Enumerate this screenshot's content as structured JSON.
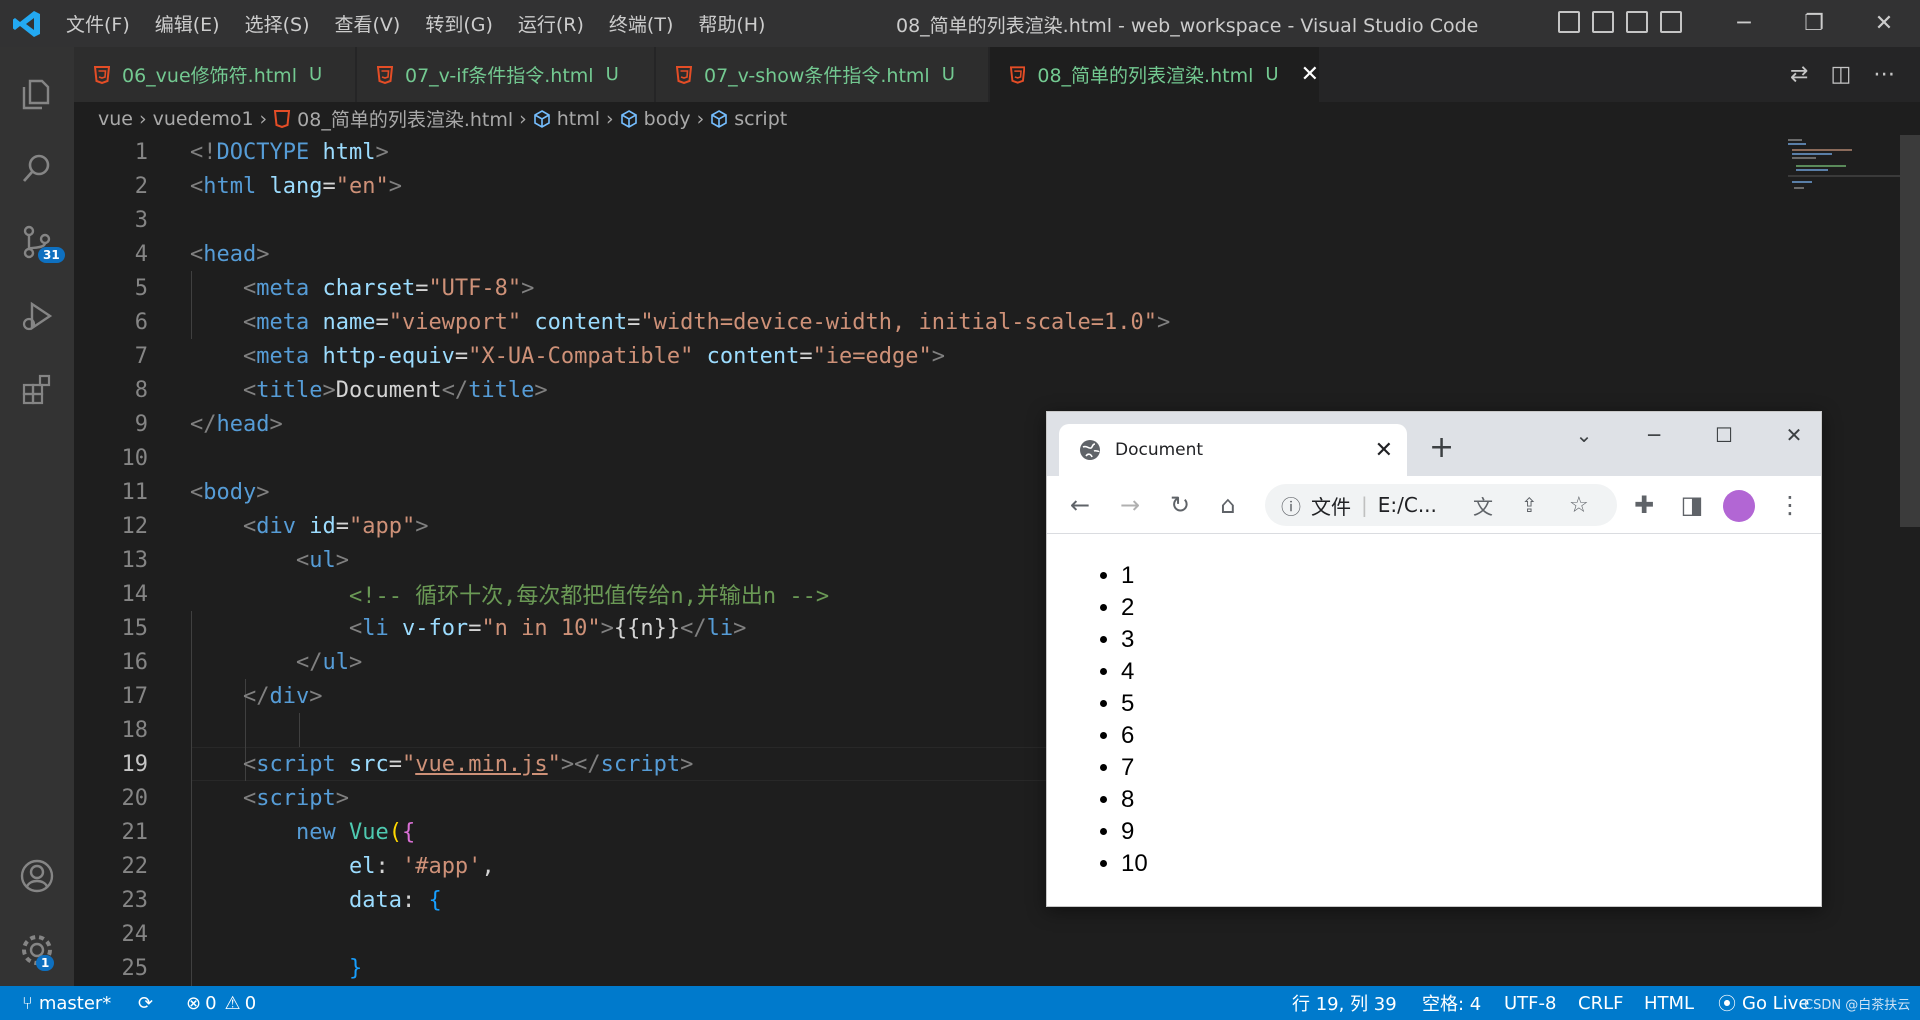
{
  "titlebar": {
    "menu": [
      "文件(F)",
      "编辑(E)",
      "选择(S)",
      "查看(V)",
      "转到(G)",
      "运行(R)",
      "终端(T)",
      "帮助(H)"
    ],
    "window_title": "08_简单的列表渲染.html - web_workspace - Visual Studio Code"
  },
  "activity": {
    "scm_badge": "31",
    "settings_badge": "1"
  },
  "tabs": [
    {
      "label": "06_vue修饰符.html",
      "status": "U"
    },
    {
      "label": "07_v-if条件指令.html",
      "status": "U"
    },
    {
      "label": "07_v-show条件指令.html",
      "status": "U"
    },
    {
      "label": "08_简单的列表渲染.html",
      "status": "U"
    }
  ],
  "breadcrumb": [
    "vue",
    "vuedemo1",
    "08_简单的列表渲染.html",
    "html",
    "body",
    "script"
  ],
  "editor": {
    "line_numbers": [
      "1",
      "2",
      "3",
      "4",
      "5",
      "6",
      "7",
      "8",
      "9",
      "10",
      "11",
      "12",
      "13",
      "14",
      "15",
      "16",
      "17",
      "18",
      "19",
      "20",
      "21",
      "22",
      "23",
      "24",
      "25"
    ],
    "current_line": 19,
    "comment": "<!-- 循环十次,每次都把值传给n,并输出n -->"
  },
  "statusbar": {
    "branch": "master*",
    "errors": "0",
    "warnings": "0",
    "position": "行 19, 列 39",
    "spaces": "空格: 4",
    "encoding": "UTF-8",
    "eol": "CRLF",
    "language": "HTML",
    "golive": "Go Live",
    "watermark": "CSDN @白茶扶云"
  },
  "browser": {
    "tab_title": "Document",
    "address_label": "文件",
    "address": "E:/C...",
    "list_items": [
      "1",
      "2",
      "3",
      "4",
      "5",
      "6",
      "7",
      "8",
      "9",
      "10"
    ]
  },
  "colors": {
    "statusbar": "#007acc",
    "activitybar": "#333333",
    "editor_bg": "#1e1e1e",
    "tab_modified": "#73c991"
  }
}
